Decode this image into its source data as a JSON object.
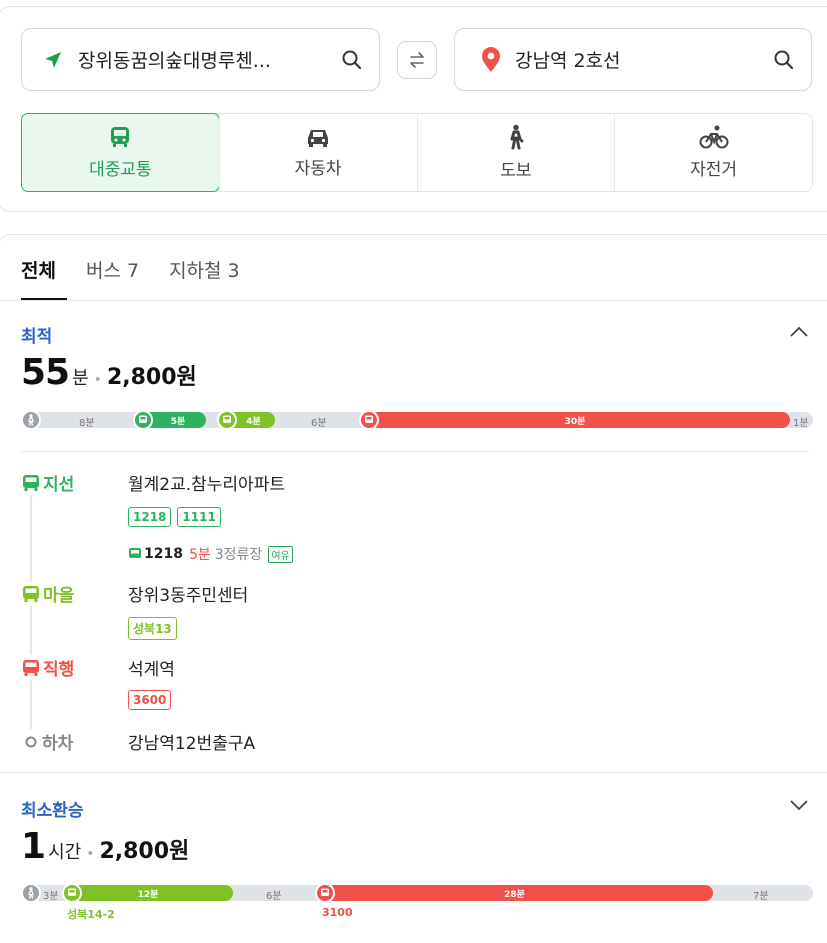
{
  "search": {
    "from": "장위동꿈의숲대명루첸...",
    "to": "강남역 2호선"
  },
  "modes": [
    {
      "label": "대중교통",
      "icon": "bus-icon",
      "active": true
    },
    {
      "label": "자동차",
      "icon": "car-icon",
      "active": false
    },
    {
      "label": "도보",
      "icon": "walk-icon",
      "active": false
    },
    {
      "label": "자전거",
      "icon": "bike-icon",
      "active": false
    }
  ],
  "tabs": [
    "전체",
    "버스 7",
    "지하철 3"
  ],
  "colors": {
    "green": "#2db35d",
    "lime": "#7fc225",
    "red": "#f1504b",
    "blue": "#2b64c6",
    "gray": "#dfe2e6"
  },
  "route1": {
    "label": "최적",
    "duration_num": "55",
    "duration_unit": "분",
    "fare": "2,800원",
    "bar": {
      "walk1": "8분",
      "seg1": "5분",
      "seg2": "4분",
      "walk2": "6분",
      "seg3": "30분",
      "walk3": "1분"
    },
    "steps": [
      {
        "type": "지선",
        "stop": "월계2교.참누리아파트",
        "chips": [
          "1218",
          "1111"
        ]
      },
      {
        "type": "마을",
        "stop": "장위3동주민센터",
        "chips": [
          "성북13"
        ]
      },
      {
        "type": "직행",
        "stop": "석계역",
        "chips": [
          "3600"
        ]
      },
      {
        "type": "하차",
        "stop": "강남역12번출구A"
      }
    ],
    "arrival": {
      "bus": "1218",
      "time": "5분",
      "stops": "3정류장",
      "seat": "여유"
    }
  },
  "route2": {
    "label": "최소환승",
    "duration_num": "1",
    "duration_unit": "시간",
    "fare": "2,800원",
    "bar": {
      "walk1": "3분",
      "seg1": "12분",
      "walk2": "6분",
      "seg2": "28분",
      "walk3": "7분"
    },
    "bus1": "성북14-2",
    "bus2": "3100"
  }
}
